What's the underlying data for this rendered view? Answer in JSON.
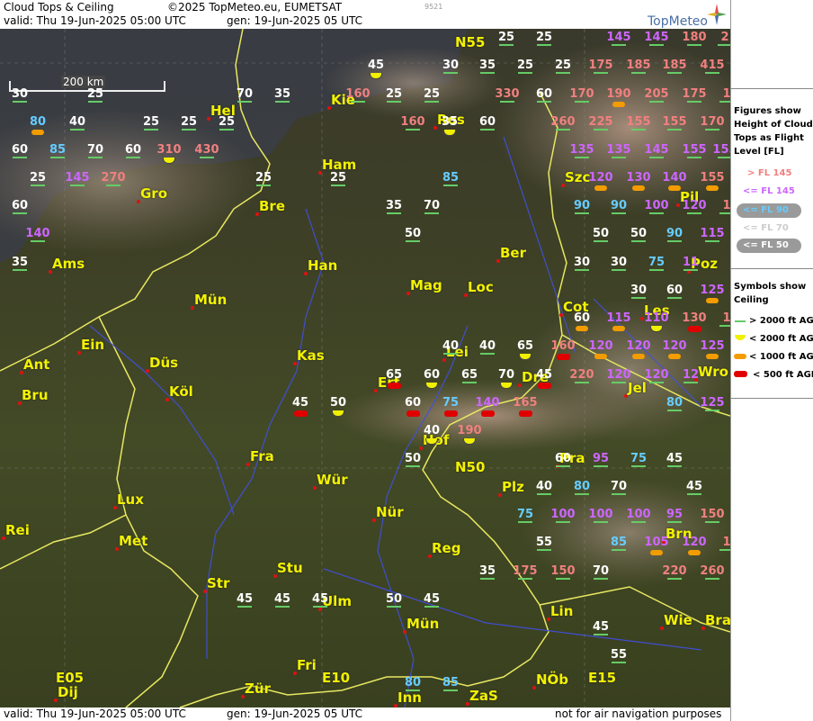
{
  "header": {
    "title": "Cloud Tops & Ceiling",
    "copyright": "©2025 TopMeteo.eu, EUMETSAT",
    "code": "9521",
    "valid": "valid:  Thu  19-Jun-2025  05:00 UTC",
    "gen": "gen: 19-Jun-2025 05 UTC",
    "logo": "TopMeteo"
  },
  "footer": {
    "valid": "valid:  Thu  19-Jun-2025  05:00 UTC",
    "gen": "gen: 19-Jun-2025 05 UTC",
    "note": "not for air navigation purposes"
  },
  "scale": {
    "label": "200 km"
  },
  "legend": {
    "title1": "Figures show",
    "title2": "Height of Cloud",
    "title3": "Tops as Flight",
    "title4": "Level  [FL]",
    "fl145_gt": "> FL 145",
    "fl145_le": "<= FL 145",
    "fl90": "<= FL 90",
    "fl70": "<= FL 70",
    "fl50": "<= FL 50",
    "sym1": "Symbols show",
    "sym2": "Ceiling",
    "c2000gt": "> 2000 ft AGL",
    "c2000lt": "< 2000 ft AGL",
    "c1000lt": "< 1000 ft AGL",
    "c500lt": "< 500 ft AGL",
    "colors": {
      "high": "#f08080",
      "mid": "#cc66ff",
      "fl90": "#66ccff",
      "fl70": "#ffffff",
      "fl50": "#ffffff",
      "green": "#66cc66",
      "yellow": "#f0f000",
      "orange": "#f39c00",
      "red": "#e00000"
    }
  },
  "cities": [
    [
      "Kie"
    ],
    [
      "Hel"
    ],
    [
      "Ham"
    ],
    [
      "Gro"
    ],
    [
      "Bre"
    ],
    [
      "Ams"
    ],
    [
      "Han"
    ],
    [
      "Ber"
    ],
    [
      "Szc"
    ],
    [
      "Pil"
    ],
    [
      "Mün"
    ],
    [
      "Mag"
    ],
    [
      "Loc"
    ],
    [
      "Poz"
    ],
    [
      "Cot"
    ],
    [
      "Les"
    ],
    [
      "Ein"
    ],
    [
      "Ant"
    ],
    [
      "Düs"
    ],
    [
      "Kas"
    ],
    [
      "Lei"
    ],
    [
      "Bru"
    ],
    [
      "Köl"
    ],
    [
      "Erf"
    ],
    [
      "Dre"
    ],
    [
      "Wro"
    ],
    [
      "Jel"
    ],
    [
      "Hof"
    ],
    [
      "Pra"
    ],
    [
      "Fra"
    ],
    [
      "Wür"
    ],
    [
      "Lux"
    ],
    [
      "Plz"
    ],
    [
      "Nür"
    ],
    [
      "Rei"
    ],
    [
      "Met"
    ],
    [
      "Reg"
    ],
    [
      "Brn"
    ],
    [
      "Stu"
    ],
    [
      "Str"
    ],
    [
      "Ulm"
    ],
    [
      "Mün"
    ],
    [
      "Lin"
    ],
    [
      "Wie"
    ],
    [
      "Bra"
    ],
    [
      "Fri"
    ],
    [
      "Dij"
    ],
    [
      "Zür"
    ],
    [
      "Inn"
    ],
    [
      "ZaS"
    ],
    [
      "NÖb"
    ],
    [
      "N55"
    ],
    [
      "N50"
    ],
    [
      "E10"
    ],
    [
      "E05"
    ],
    [
      "E15"
    ],
    [
      "Ros"
    ]
  ],
  "values": [
    [
      "25",
      "w"
    ],
    [
      "25",
      "w"
    ],
    [
      "145",
      "m"
    ],
    [
      "145",
      "m"
    ],
    [
      "180",
      "h"
    ],
    [
      "2",
      "h"
    ],
    [
      "45",
      "y"
    ],
    [
      "30",
      "w"
    ],
    [
      "35",
      "w"
    ],
    [
      "25",
      "w"
    ],
    [
      "25",
      "w"
    ],
    [
      "175",
      "h"
    ],
    [
      "185",
      "h"
    ],
    [
      "185",
      "h"
    ],
    [
      "415",
      "h"
    ],
    [
      "30",
      "w"
    ],
    [
      "25",
      "w"
    ],
    [
      "70",
      "w"
    ],
    [
      "35",
      "w"
    ],
    [
      "160",
      "h"
    ],
    [
      "25",
      "w"
    ],
    [
      "25",
      "w"
    ],
    [
      "330",
      "h"
    ],
    [
      "60",
      "w"
    ],
    [
      "170",
      "h"
    ],
    [
      "190",
      "ho"
    ],
    [
      "205",
      "h"
    ],
    [
      "175",
      "h"
    ],
    [
      "1",
      "h"
    ],
    [
      "80",
      "co"
    ],
    [
      "40",
      "w"
    ],
    [
      "25",
      "w"
    ],
    [
      "25",
      "w"
    ],
    [
      "25",
      "w"
    ],
    [
      "160",
      "h"
    ],
    [
      "35",
      "y"
    ],
    [
      "60",
      "w"
    ],
    [
      "260",
      "h"
    ],
    [
      "225",
      "h"
    ],
    [
      "155",
      "h"
    ],
    [
      "155",
      "h"
    ],
    [
      "170",
      "h"
    ],
    [
      "60",
      "w"
    ],
    [
      "85",
      "c"
    ],
    [
      "70",
      "w"
    ],
    [
      "60",
      "w"
    ],
    [
      "310",
      "hy"
    ],
    [
      "430",
      "h"
    ],
    [
      "135",
      "m"
    ],
    [
      "135",
      "m"
    ],
    [
      "145",
      "m"
    ],
    [
      "155",
      "m"
    ],
    [
      "155",
      "m"
    ],
    [
      "25",
      "w"
    ],
    [
      "145",
      "m"
    ],
    [
      "270",
      "h"
    ],
    [
      "25",
      "w"
    ],
    [
      "25",
      "w"
    ],
    [
      "85",
      "c"
    ],
    [
      "120",
      "mo"
    ],
    [
      "130",
      "mo"
    ],
    [
      "140",
      "mo"
    ],
    [
      "155",
      "ho"
    ],
    [
      "60",
      "w"
    ],
    [
      "35",
      "w"
    ],
    [
      "70",
      "w"
    ],
    [
      "90",
      "c"
    ],
    [
      "90",
      "c"
    ],
    [
      "100",
      "m"
    ],
    [
      "120",
      "m"
    ],
    [
      "1",
      "h"
    ],
    [
      "140",
      "m"
    ],
    [
      "50",
      "w"
    ],
    [
      "50",
      "w"
    ],
    [
      "50",
      "w"
    ],
    [
      "90",
      "c"
    ],
    [
      "115",
      "m"
    ],
    [
      "35",
      "w"
    ],
    [
      "30",
      "w"
    ],
    [
      "30",
      "w"
    ],
    [
      "75",
      "c"
    ],
    [
      "11",
      "m"
    ],
    [
      "30",
      "w"
    ],
    [
      "60",
      "w"
    ],
    [
      "125",
      "mo"
    ],
    [
      "60",
      "wo"
    ],
    [
      "115",
      "mo"
    ],
    [
      "110",
      "my"
    ],
    [
      "130",
      "hr"
    ],
    [
      "1",
      "h"
    ],
    [
      "40",
      "w"
    ],
    [
      "40",
      "w"
    ],
    [
      "65",
      "y"
    ],
    [
      "160",
      "hr"
    ],
    [
      "120",
      "mo"
    ],
    [
      "120",
      "mo"
    ],
    [
      "120",
      "mo"
    ],
    [
      "125",
      "mo"
    ],
    [
      "65",
      "r"
    ],
    [
      "60",
      "y"
    ],
    [
      "65",
      "w"
    ],
    [
      "70",
      "y"
    ],
    [
      "45",
      "r"
    ],
    [
      "220",
      "h"
    ],
    [
      "120",
      "m"
    ],
    [
      "120",
      "m"
    ],
    [
      "12",
      "m"
    ],
    [
      "45",
      "r"
    ],
    [
      "50",
      "y"
    ],
    [
      "60",
      "r"
    ],
    [
      "75",
      "cr"
    ],
    [
      "140",
      "mr"
    ],
    [
      "165",
      "hr"
    ],
    [
      "80",
      "c"
    ],
    [
      "125",
      "m"
    ],
    [
      "40",
      "y"
    ],
    [
      "190",
      "hy"
    ],
    [
      "50",
      "w"
    ],
    [
      "60",
      "w"
    ],
    [
      "95",
      "m"
    ],
    [
      "75",
      "c"
    ],
    [
      "45",
      "w"
    ],
    [
      "40",
      "w"
    ],
    [
      "80",
      "c"
    ],
    [
      "70",
      "w"
    ],
    [
      "45",
      "w"
    ],
    [
      "75",
      "c"
    ],
    [
      "100",
      "m"
    ],
    [
      "100",
      "m"
    ],
    [
      "100",
      "m"
    ],
    [
      "95",
      "m"
    ],
    [
      "150",
      "h"
    ],
    [
      "55",
      "w"
    ],
    [
      "85",
      "c"
    ],
    [
      "105",
      "mo"
    ],
    [
      "120",
      "mo"
    ],
    [
      "1",
      "h"
    ],
    [
      "35",
      "w"
    ],
    [
      "175",
      "h"
    ],
    [
      "150",
      "h"
    ],
    [
      "70",
      "w"
    ],
    [
      "220",
      "h"
    ],
    [
      "260",
      "h"
    ],
    [
      "45",
      "w"
    ],
    [
      "45",
      "w"
    ],
    [
      "45",
      "w"
    ],
    [
      "50",
      "w"
    ],
    [
      "45",
      "w"
    ],
    [
      "45",
      "w"
    ],
    [
      "55",
      "w"
    ],
    [
      "80",
      "c"
    ],
    [
      "85",
      "c"
    ]
  ]
}
